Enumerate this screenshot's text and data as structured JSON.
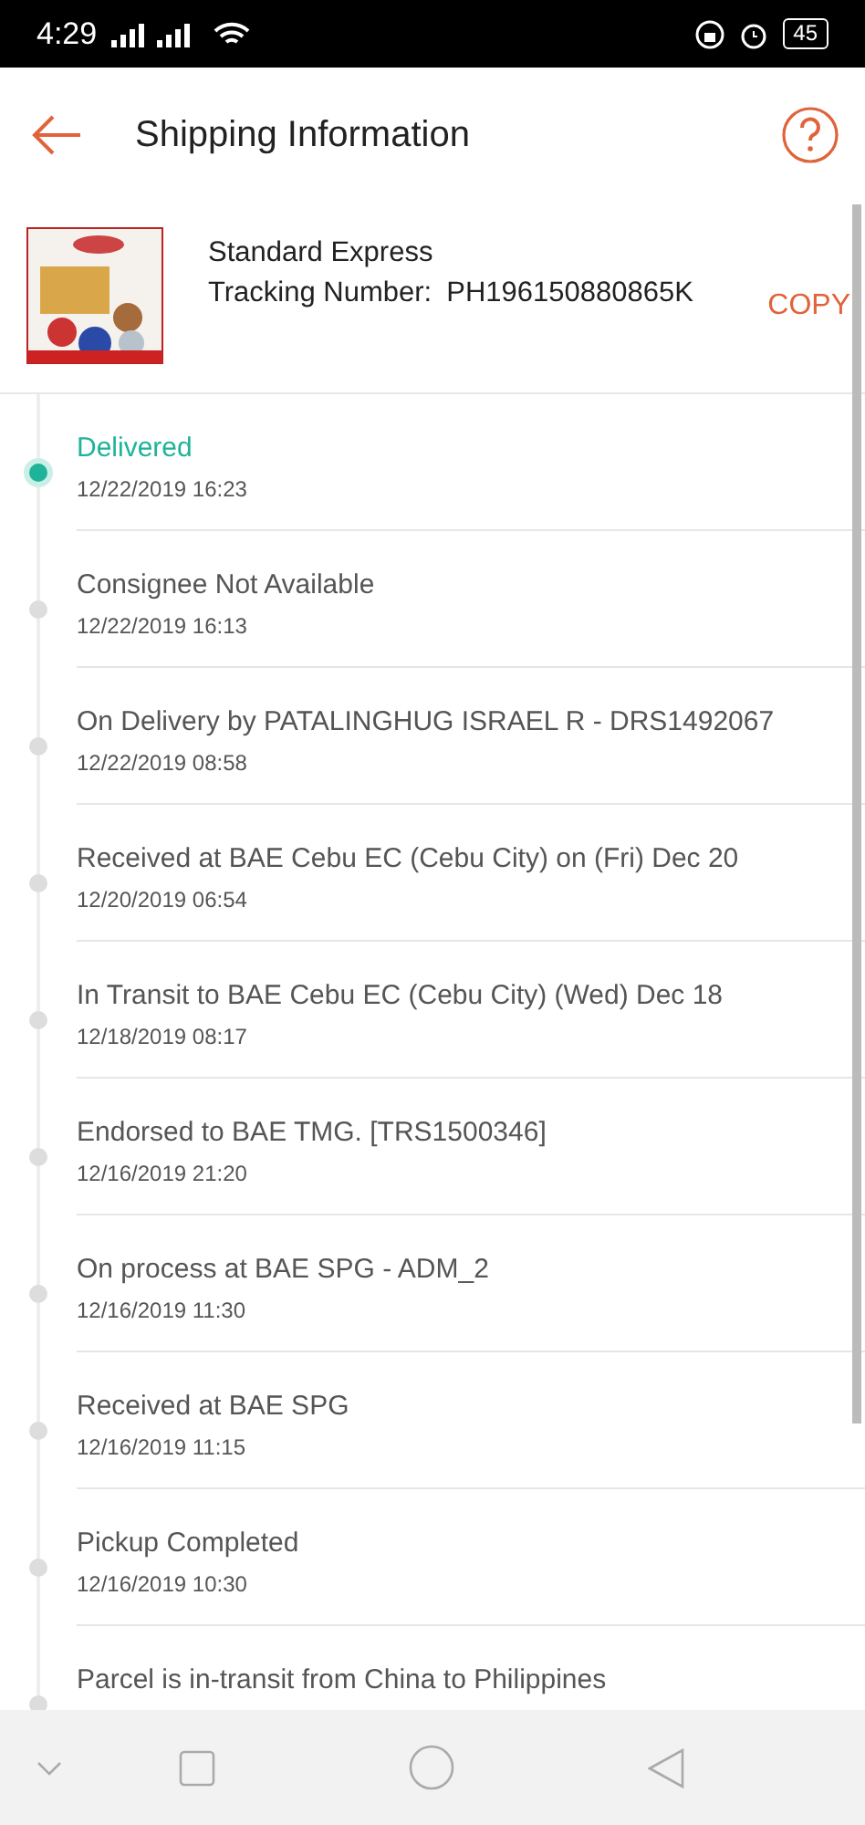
{
  "status_bar": {
    "time": "4:29",
    "battery": "45"
  },
  "header": {
    "title": "Shipping Information"
  },
  "shipment": {
    "carrier": "Standard Express",
    "tracking_label": "Tracking Number:",
    "tracking_number": "PH196150880865K",
    "copy_button": "COPY"
  },
  "events": [
    {
      "status": "Delivered",
      "time": "12/22/2019 16:23",
      "active": true
    },
    {
      "status": "Consignee Not Available",
      "time": "12/22/2019 16:13",
      "active": false
    },
    {
      "status": "On Delivery by PATALINGHUG ISRAEL R - DRS1492067",
      "time": "12/22/2019 08:58",
      "active": false
    },
    {
      "status": "Received at BAE Cebu EC (Cebu City) on (Fri) Dec 20",
      "time": "12/20/2019 06:54",
      "active": false
    },
    {
      "status": "In Transit to BAE Cebu EC (Cebu City) (Wed) Dec 18",
      "time": "12/18/2019 08:17",
      "active": false
    },
    {
      "status": "Endorsed to BAE TMG. [TRS1500346]",
      "time": "12/16/2019 21:20",
      "active": false
    },
    {
      "status": "On process at BAE SPG - ADM_2",
      "time": "12/16/2019 11:30",
      "active": false
    },
    {
      "status": "Received at BAE SPG",
      "time": "12/16/2019 11:15",
      "active": false
    },
    {
      "status": "Pickup Completed",
      "time": "12/16/2019 10:30",
      "active": false
    },
    {
      "status": "Parcel is in-transit from China to Philippines",
      "active": false
    }
  ]
}
